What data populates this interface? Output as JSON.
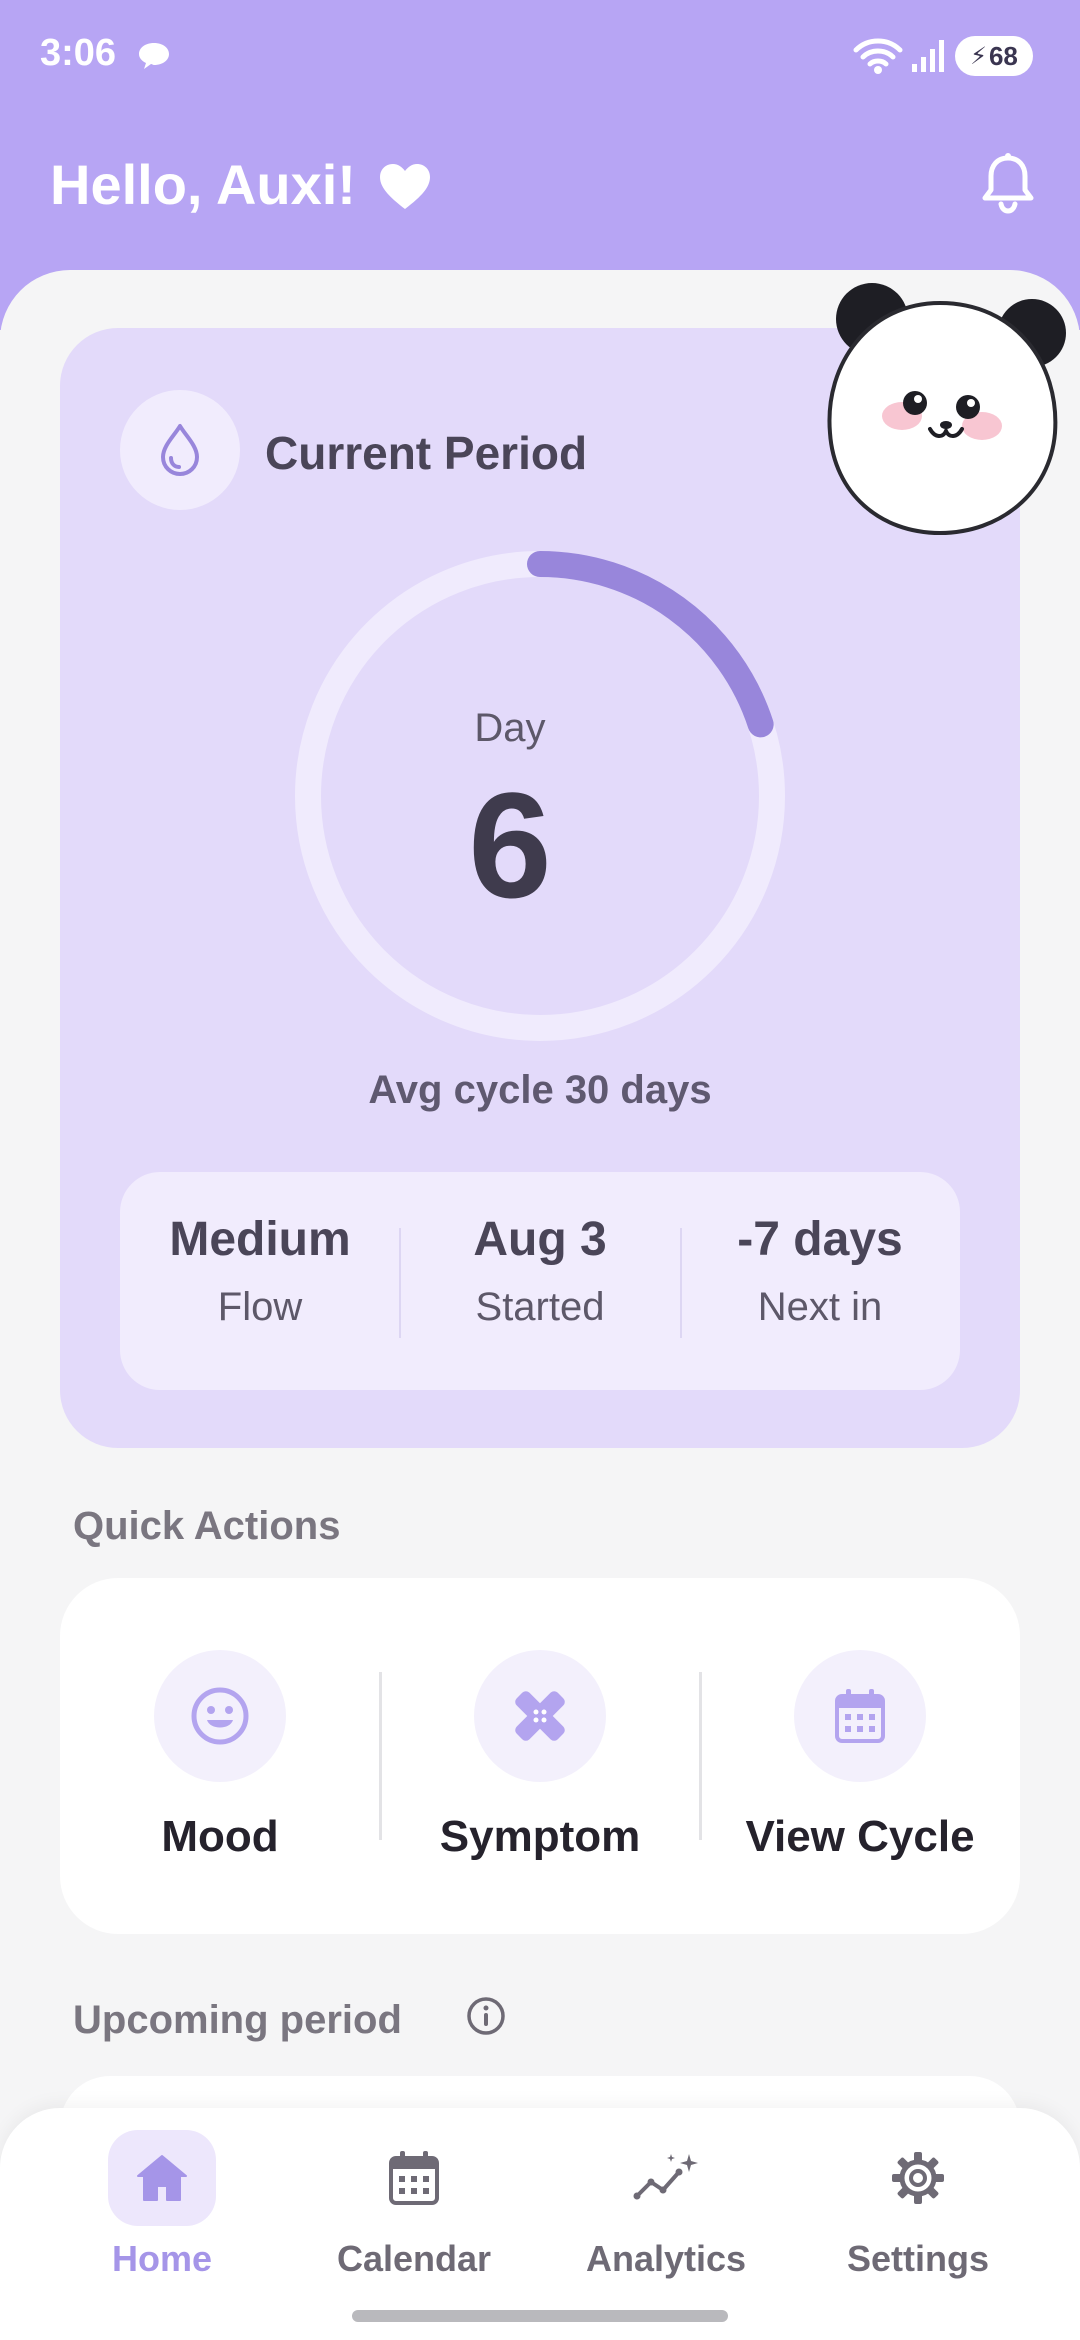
{
  "status_bar": {
    "time": "3:06",
    "battery": "68",
    "icons": [
      "chat-bubble-icon",
      "wifi-icon",
      "signal-icon",
      "battery-icon"
    ]
  },
  "header": {
    "greeting": "Hello, Auxi!",
    "greeting_icon": "heart-icon",
    "notification_icon": "bell-icon"
  },
  "current_period": {
    "title": "Current Period",
    "icon": "drop-icon",
    "day_label": "Day",
    "day_number": "6",
    "avg_cycle": "Avg cycle 30 days",
    "progress_fraction": 0.2,
    "stats": [
      {
        "value": "Medium",
        "label": "Flow"
      },
      {
        "value": "Aug 3",
        "label": "Started"
      },
      {
        "value": "-7 days",
        "label": "Next in"
      }
    ]
  },
  "quick_actions": {
    "title": "Quick Actions",
    "items": [
      {
        "label": "Mood",
        "icon": "smile-icon"
      },
      {
        "label": "Symptom",
        "icon": "bandage-icon"
      },
      {
        "label": "View Cycle",
        "icon": "calendar-icon"
      }
    ]
  },
  "upcoming": {
    "title": "Upcoming period",
    "icon": "info-icon"
  },
  "bottom_nav": {
    "items": [
      {
        "label": "Home",
        "icon": "home-icon",
        "active": true
      },
      {
        "label": "Calendar",
        "icon": "calendar-icon",
        "active": false
      },
      {
        "label": "Analytics",
        "icon": "analytics-icon",
        "active": false
      },
      {
        "label": "Settings",
        "icon": "gear-icon",
        "active": false
      }
    ]
  },
  "colors": {
    "header_bg": "#b7a5f4",
    "card_bg": "#e3dafa",
    "accent": "#9886db",
    "active_nav": "#a595e8"
  }
}
